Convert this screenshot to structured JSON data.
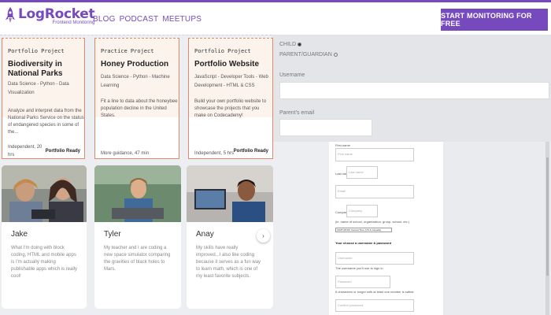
{
  "header": {
    "logo_word": "LogRocket",
    "logo_sub": "Frontend Monitoring",
    "nav": [
      "BLOG",
      "PODCAST",
      "MEETUPS"
    ],
    "cta_label": "START MONITORING FOR FREE"
  },
  "overlay_form": {
    "radio_child": "CHILD",
    "radio_parent": "PARENT/GUARDIAN",
    "username_label": "Username",
    "parent_email_label": "Parent's email"
  },
  "projects": [
    {
      "type": "Portfolio Project",
      "title": "Biodiversity in National Parks",
      "tags": "Data Science - Python - Data Visualization",
      "description": "Analyze and interpret data from the National Parks Service on the status of endangered species in some of the...",
      "time": "Independent, 20 hrs",
      "badge": "Portfolio Ready"
    },
    {
      "type": "Practice Project",
      "title": "Honey Production",
      "tags": "Data Science - Python - Machine Learning",
      "description": "Fit a line to data about the honeybee population decline in the United States.",
      "time": "More guidance, 47 min",
      "badge": ""
    },
    {
      "type": "Portfolio Project",
      "title": "Portfolio Website",
      "tags": "JavaScript - Developer Tools - Web Development - HTML & CSS",
      "description": "Build your own portfolio website to showcase the projects that you make on Codecademy!",
      "time": "Independent, 5 hrs",
      "badge": "Portfolio Ready"
    }
  ],
  "testimonials": [
    {
      "name": "Jake",
      "quote": "What I'm doing with block coding, HTML and mobile apps is I'm actually making publishable apps which is really cool!"
    },
    {
      "name": "Tyler",
      "quote": "My teacher and I are coding a new space simulator comparing the gravities of black holes to Mars."
    },
    {
      "name": "Anay",
      "quote": "My skills have really improved...I also like coding because it serves as a fun way to learn math, which is one of my least favorite subjects."
    }
  ],
  "right_form": {
    "first_name_label": "First name",
    "first_name_placeholder": "First name",
    "last_name_label": "Last name",
    "last_name_placeholder": "Last name",
    "email_placeholder": "Email",
    "company_label": "Company",
    "company_placeholder": "Company",
    "org_note": "(ie. name of school, organization, group, school, etc.)",
    "timezone_value": "(GMT-08:00) Central Time (US & Canada)",
    "choose_heading": "Your choose a username & password",
    "username_placeholder": "Username",
    "username_note": "The username you'll use to sign in",
    "password_placeholder": "Password",
    "password_note": "6 characters or longer with at least one number is safest.",
    "confirm_placeholder": "Confirm password"
  }
}
